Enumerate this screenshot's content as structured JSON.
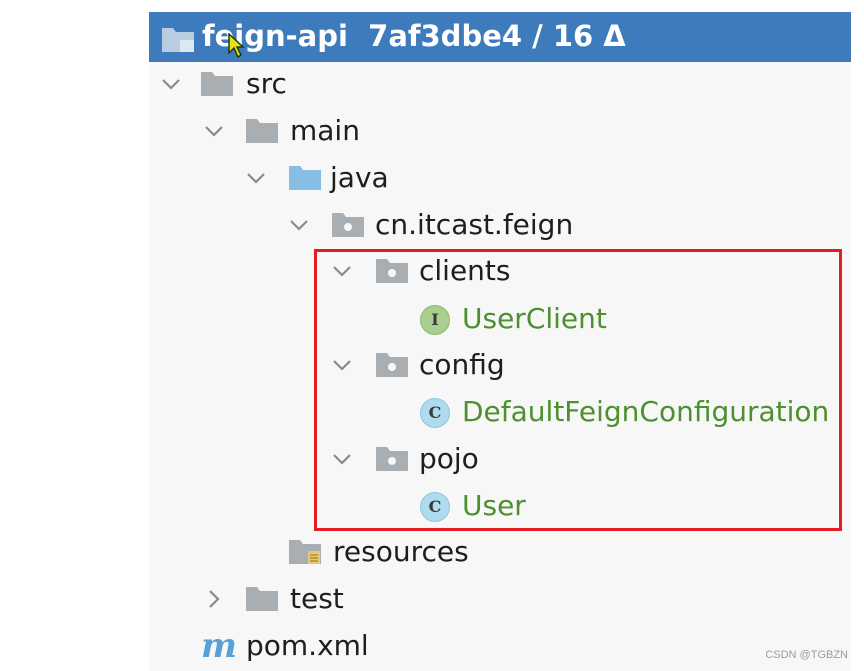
{
  "project": {
    "name": "feign-api",
    "vcs_info": "7af3dbe4 / 16 Δ",
    "title_color": "#3e7bbd"
  },
  "tree": {
    "src": {
      "label": "src",
      "expanded": true
    },
    "main": {
      "label": "main",
      "expanded": true
    },
    "java": {
      "label": "java",
      "expanded": true
    },
    "package": {
      "label": "cn.itcast.feign",
      "expanded": true
    },
    "clients": {
      "label": "clients",
      "expanded": true
    },
    "user_client": {
      "label": "UserClient",
      "kind": "interface",
      "badge": "I"
    },
    "config": {
      "label": "config",
      "expanded": true
    },
    "default_config": {
      "label": "DefaultFeignConfiguration",
      "kind": "class",
      "badge": "C"
    },
    "pojo": {
      "label": "pojo",
      "expanded": true
    },
    "user": {
      "label": "User",
      "kind": "class",
      "badge": "C"
    },
    "resources": {
      "label": "resources"
    },
    "test": {
      "label": "test",
      "expanded": false
    },
    "pom": {
      "label": "pom.xml",
      "icon": "m"
    }
  },
  "colors": {
    "highlight_border": "#e41b23",
    "class_text": "#4e8f2f",
    "interface_badge": "#a8cf8f",
    "class_badge": "#aedbee"
  },
  "watermark": "CSDN @TGBZN"
}
